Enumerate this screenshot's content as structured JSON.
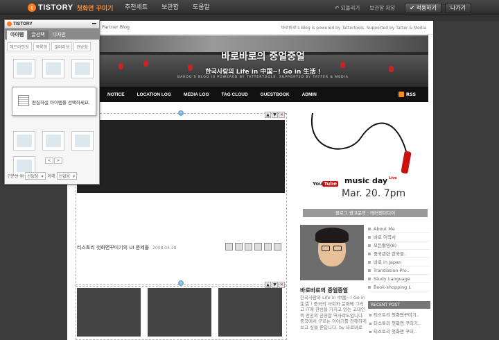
{
  "topbar": {
    "logo": "TISTORY",
    "logo_mark": "t",
    "subtitle": "첫화면 꾸미기",
    "nav": [
      "추천세트",
      "보관함",
      "도움말"
    ],
    "undo": "되돌리기",
    "save": "보관함 저장",
    "apply": "적용하기",
    "exit": "나가기"
  },
  "blog": {
    "partner": "Partner Blog",
    "credit": "바로바로's Blog is powered by Tattertools. Supported by Tatter & Media",
    "title": "바로바로의 중얼중얼",
    "subtitle": "한국사람의 Life in 中国~! Go in 生活 !",
    "tagline": "BAROO'S BLOG IS POWERED BY TATTERTOOLS. SUPPORTED BY TATTER & MEDIA",
    "menu": [
      "NOTICE",
      "LOCATION LOG",
      "MEDIA LOG",
      "TAG CLOUD",
      "GUESTBOOK",
      "ADMIN"
    ],
    "rss": "RSS",
    "post_title": "티스토리 첫화면꾸미기의 UI 문제들",
    "post_date": "2008.03.18",
    "youtube_you": "You",
    "youtube_tube": "Tube",
    "music": "music day",
    "music_sup": "Live",
    "music_date": "Mar. 20. 7pm",
    "banner_caption": "블로그 광고문의 : 태터앤미디어",
    "side_list": [
      "About Me",
      "바로 이력서",
      "모든촬영(8)",
      "중국관련 한국블..",
      "바로 in Japan",
      "Translation Pro..",
      "Study Language",
      "Book-shopping L"
    ],
    "profile_name": "바로바로의 중얼중얼",
    "profile_desc": "한국사람의 Life in 中国~! Go in 生活 ! 중국의 사회와 문화에 그리고 IT에 관심을 가지고 있는 고대인쪽 전공의 공영합 역사학도입니다. 중국에서 구르는 이야기를 전해하게 쓰고 싶을 뿐입니다. by 바로바로",
    "recent_head": "RECENT POST",
    "recent_list": [
      "티스토리 첫화면꾸미기..",
      "티스토리 첫화면 꾸미기..",
      "티스토리 첫화면 꾸미.."
    ]
  },
  "panel": {
    "logo": "TISTORY",
    "tabs": [
      "아이템",
      "글선택",
      "디자인"
    ],
    "subtabs": [
      "헤드라인형",
      "목록형",
      "갤러리형",
      "전방형"
    ],
    "tooltip": "편집하실 아이템을 선택하세요.",
    "pager_prev": "<",
    "pager_next": ">",
    "foot": [
      "구분선",
      "위",
      "선없음",
      "아래",
      "선없음"
    ]
  }
}
